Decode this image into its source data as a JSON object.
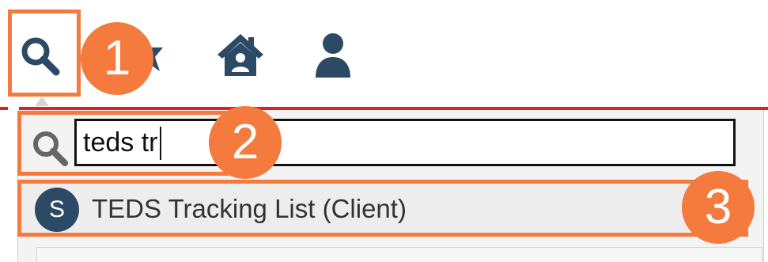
{
  "toolbar": {
    "icons": [
      "search-icon",
      "star-icon",
      "home-icon",
      "user-icon"
    ]
  },
  "search": {
    "value": "teds tr"
  },
  "results": [
    {
      "badge": "S",
      "label": "TEDS Tracking List (Client)"
    }
  ],
  "callouts": [
    "1",
    "2",
    "3"
  ],
  "colors": {
    "icon": "#2c4a66",
    "callout": "#f47a3d",
    "accent_line": "#e02020",
    "dropdown_bg": "#f3f3f3",
    "input_icon": "#666666"
  }
}
